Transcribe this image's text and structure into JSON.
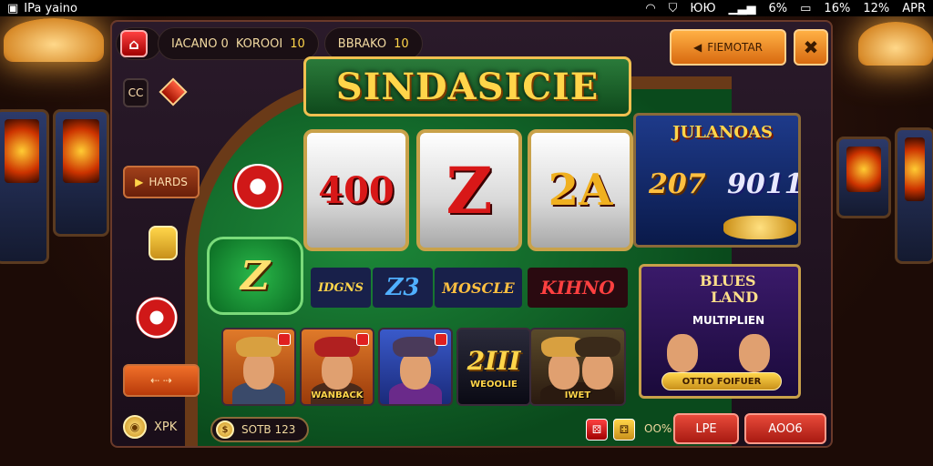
{
  "statusbar": {
    "app_name": "IPa yaino",
    "icons": [
      "wifi-icon",
      "shield-icon",
      "signal-icon",
      "battery-icon"
    ],
    "signal_text": "ЮЮ",
    "percent_text": "6%",
    "battery_text": "16%",
    "time_text": "12%",
    "month_text": "APR"
  },
  "topbar": {
    "mode_label": "IACANO 0",
    "balance_label": "KOROOI",
    "balance_value": "10",
    "bet_label": "BBRAKO",
    "bet_value": "10",
    "promo_button": "FIEMOTAR",
    "settings_icon": "tools-icon"
  },
  "title": "SINDASICIE",
  "reels": [
    {
      "symbol": "400",
      "color": "#d81818"
    },
    {
      "symbol": "Z",
      "color": "#d81818"
    },
    {
      "symbol": "2A",
      "color": "#f0b020"
    }
  ],
  "bonus": {
    "title": "JULANOAS",
    "left_value": "207",
    "right_value": "9011"
  },
  "sidebar": {
    "cc_label": "CC",
    "hard_label": "HARDS",
    "arrows_label": "⇠ ⇢",
    "coin_label": "XPK"
  },
  "feature_symbol": "Z",
  "logos": [
    {
      "text": "IDGNS",
      "color": "#ffd54a",
      "bg": "#18204a"
    },
    {
      "text": "Z3",
      "color": "#50b0ff",
      "bg": "#18204a"
    },
    {
      "text": "MOSCLE",
      "color": "#ffc040",
      "bg": "#18204a"
    },
    {
      "text": "KIHNO",
      "color": "#ff4040",
      "bg": "#2a0a10"
    }
  ],
  "cards": [
    {
      "label": "",
      "hat": "#d8a040",
      "bg": "#c85a1a",
      "body": "#3a4a6a"
    },
    {
      "label": "WANBACK",
      "hat": "#b02020",
      "bg": "#c85a1a",
      "body": "#4a2a1a"
    },
    {
      "label": "",
      "hat": "#4a3a5a",
      "bg": "#2a3a8a",
      "body": "#6a2a8a"
    },
    {
      "label": "WEOOLIE",
      "number": "2III",
      "hat": "",
      "bg": "#1a1a2a",
      "body": ""
    },
    {
      "label": "IWET",
      "hat": "#d8a040",
      "bg": "#3a2a1a",
      "body": "#2a1a10"
    }
  ],
  "blues": {
    "title_line1": "BLUES",
    "title_line2": "LAND",
    "subtitle": "MULTIPLIEN",
    "footer": "OTTIO FOIFUER"
  },
  "bottombar": {
    "coin_symbol": "$",
    "bet_text": "SOTB 123",
    "percent_text": "OO%",
    "left_button": "LPE",
    "right_button": "AOO6"
  }
}
